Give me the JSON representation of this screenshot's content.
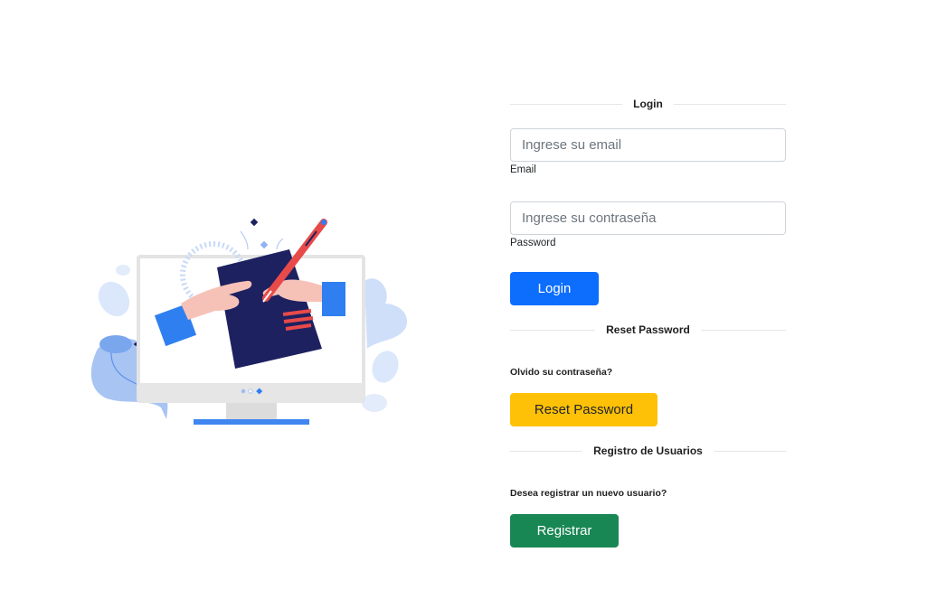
{
  "login": {
    "heading": "Login",
    "email_placeholder": "Ingrese su email",
    "email_label": "Email",
    "password_placeholder": "Ingrese su contraseña",
    "password_label": "Password",
    "button": "Login"
  },
  "reset": {
    "heading": "Reset Password",
    "question": "Olvido su contraseña?",
    "button": "Reset Password"
  },
  "register": {
    "heading": "Registro de Usuarios",
    "question": "Desea registrar un nuevo usuario?",
    "button": "Registrar"
  },
  "colors": {
    "primary": "#0d6efd",
    "warning": "#ffc107",
    "success": "#198754",
    "illustration_navy": "#1e2160",
    "illustration_blue": "#2f7ff0"
  }
}
